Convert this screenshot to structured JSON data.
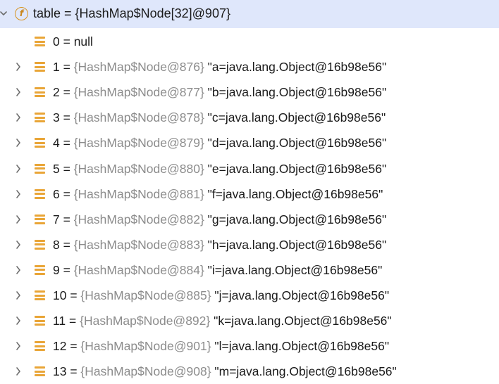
{
  "root": {
    "badge": "f",
    "label": "table = {HashMap$Node[32]@907}"
  },
  "items": [
    {
      "index": "0",
      "eq": " = ",
      "type": "",
      "value": "null",
      "expandable": false
    },
    {
      "index": "1",
      "eq": " = ",
      "type": "{HashMap$Node@876}",
      "value": " \"a=java.lang.Object@16b98e56\"",
      "expandable": true
    },
    {
      "index": "2",
      "eq": " = ",
      "type": "{HashMap$Node@877}",
      "value": " \"b=java.lang.Object@16b98e56\"",
      "expandable": true
    },
    {
      "index": "3",
      "eq": " = ",
      "type": "{HashMap$Node@878}",
      "value": " \"c=java.lang.Object@16b98e56\"",
      "expandable": true
    },
    {
      "index": "4",
      "eq": " = ",
      "type": "{HashMap$Node@879}",
      "value": " \"d=java.lang.Object@16b98e56\"",
      "expandable": true
    },
    {
      "index": "5",
      "eq": " = ",
      "type": "{HashMap$Node@880}",
      "value": " \"e=java.lang.Object@16b98e56\"",
      "expandable": true
    },
    {
      "index": "6",
      "eq": " = ",
      "type": "{HashMap$Node@881}",
      "value": " \"f=java.lang.Object@16b98e56\"",
      "expandable": true
    },
    {
      "index": "7",
      "eq": " = ",
      "type": "{HashMap$Node@882}",
      "value": " \"g=java.lang.Object@16b98e56\"",
      "expandable": true
    },
    {
      "index": "8",
      "eq": " = ",
      "type": "{HashMap$Node@883}",
      "value": " \"h=java.lang.Object@16b98e56\"",
      "expandable": true
    },
    {
      "index": "9",
      "eq": " = ",
      "type": "{HashMap$Node@884}",
      "value": " \"i=java.lang.Object@16b98e56\"",
      "expandable": true
    },
    {
      "index": "10",
      "eq": " = ",
      "type": "{HashMap$Node@885}",
      "value": " \"j=java.lang.Object@16b98e56\"",
      "expandable": true
    },
    {
      "index": "11",
      "eq": " = ",
      "type": "{HashMap$Node@892}",
      "value": " \"k=java.lang.Object@16b98e56\"",
      "expandable": true
    },
    {
      "index": "12",
      "eq": " = ",
      "type": "{HashMap$Node@901}",
      "value": " \"l=java.lang.Object@16b98e56\"",
      "expandable": true
    },
    {
      "index": "13",
      "eq": " = ",
      "type": "{HashMap$Node@908}",
      "value": " \"m=java.lang.Object@16b98e56\"",
      "expandable": true
    }
  ],
  "colors": {
    "selection": "#dfe7fb",
    "entry_icon": "#e9a537",
    "field_badge": "#d89421",
    "type_text": "#8c8c8c",
    "value_text": "#1a1a1a"
  },
  "icons": {
    "root_expander": "chevron-down-icon",
    "root_badge": "field-icon",
    "child_expander": "chevron-right-icon",
    "entry": "array-entry-icon"
  }
}
